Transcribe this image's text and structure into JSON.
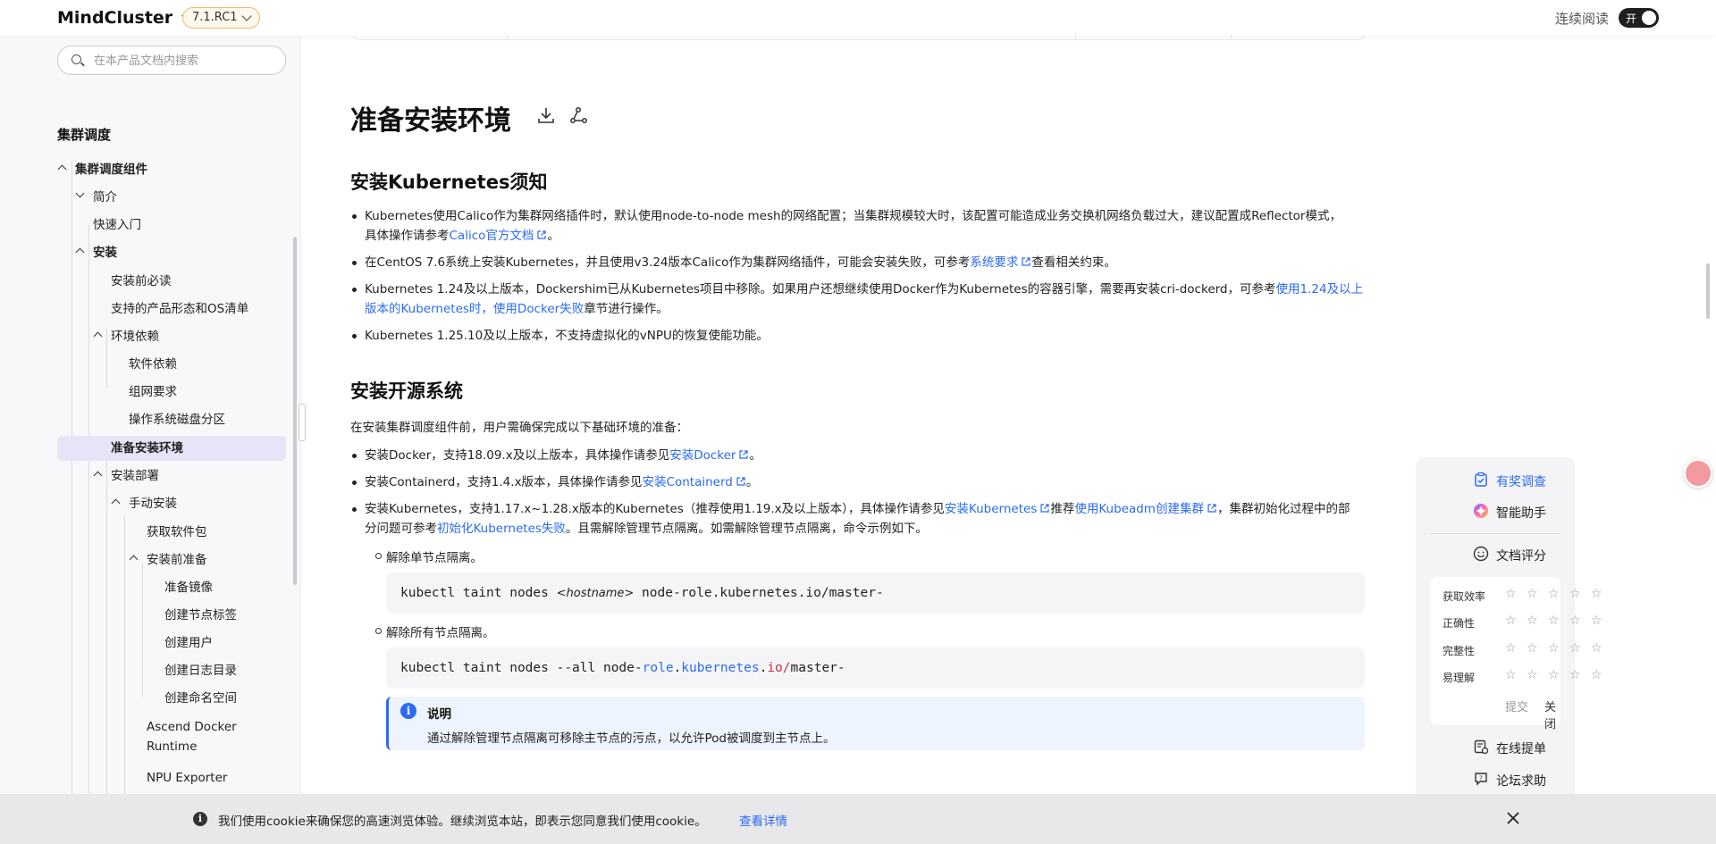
{
  "header": {
    "brand": "MindCluster",
    "version": "7.1.RC1",
    "continuous_reading": "连续阅读",
    "toggle_label": "开"
  },
  "sidebar": {
    "search_placeholder": "在本产品文档内搜索",
    "title": "集群调度",
    "items": [
      {
        "label": "集群调度组件",
        "level": 1,
        "expanded": true
      },
      {
        "label": "简介",
        "level": 2,
        "expanded": true
      },
      {
        "label": "快速入门",
        "level": 2
      },
      {
        "label": "安装",
        "level": 2,
        "expanded": true
      },
      {
        "label": "安装前必读",
        "level": 3
      },
      {
        "label": "支持的产品形态和OS清单",
        "level": 3
      },
      {
        "label": "环境依赖",
        "level": 3,
        "expanded": true
      },
      {
        "label": "软件依赖",
        "level": 4
      },
      {
        "label": "组网要求",
        "level": 4
      },
      {
        "label": "操作系统磁盘分区",
        "level": 4
      },
      {
        "label": "准备安装环境",
        "level": 3,
        "active": true
      },
      {
        "label": "安装部署",
        "level": 3,
        "expanded": true
      },
      {
        "label": "手动安装",
        "level": 4,
        "expanded": true
      },
      {
        "label": "获取软件包",
        "level": 5
      },
      {
        "label": "安装前准备",
        "level": 5,
        "expanded": true
      },
      {
        "label": "准备镜像",
        "level": 6
      },
      {
        "label": "创建节点标签",
        "level": 6
      },
      {
        "label": "创建用户",
        "level": 6
      },
      {
        "label": "创建日志目录",
        "level": 6
      },
      {
        "label": "创建命名空间",
        "level": 6
      },
      {
        "label": "Ascend Docker",
        "label2": "Runtime",
        "level": 5
      },
      {
        "label": "NPU Exporter",
        "level": 5
      }
    ]
  },
  "main": {
    "page_title": "准备安装环境",
    "section1": {
      "heading": "安装Kubernetes须知",
      "b1_text": "Kubernetes使用Calico作为集群网络插件时，默认使用node-to-node mesh的网络配置；当集群规模较大时，该配置可能造成业务交换机网络负载过大，建议配置成Reflector模式，",
      "b1_text2": "具体操作请参考",
      "b1_link": "Calico官方文档",
      "b1_end": "。",
      "b2_text": "在CentOS 7.6系统上安装Kubernetes，并且使用v3.24版本Calico作为集群网络插件，可能会安装失败，可参考",
      "b2_link": "系统要求",
      "b2_end": "查看相关约束。",
      "b3_text": "Kubernetes 1.24及以上版本，Dockershim已从Kubernetes项目中移除。如果用户还想继续使用Docker作为Kubernetes的容器引擎，需要再安装cri-dockerd，可参考",
      "b3_link": "使用1.24及以上",
      "b3_link2": "版本的Kubernetes时，使用Docker失败",
      "b3_end": "章节进行操作。",
      "b4_text": "Kubernetes 1.25.10及以上版本，不支持虚拟化的vNPU的恢复使能功能。"
    },
    "section2": {
      "heading": "安装开源系统",
      "intro": "在安装集群调度组件前，用户需确保完成以下基础环境的准备：",
      "b1_text": "安装Docker，支持18.09.x及以上版本，具体操作请参见",
      "b1_link": "安装Docker",
      "b1_end": "。",
      "b2_text": "安装Containerd，支持1.4.x版本，具体操作请参见",
      "b2_link": "安装Containerd",
      "b2_end": "。",
      "b3_text": "安装Kubernetes，支持1.17.x~1.28.x版本的Kubernetes（推荐使用1.19.x及以上版本），具体操作请参见",
      "b3_link": "安装Kubernetes",
      "b3_mid": "推荐",
      "b3_link2": "使用Kubeadm创建集群",
      "b3_end": "，集群初始化过程中的部",
      "b3_line2_text": "分问题可参考",
      "b3_line2_link": "初始化Kubernetes失败",
      "b3_line2_end": "。且需解除管理节点隔离。如需解除管理节点隔离，命令示例如下。",
      "sub1": "解除单节点隔离。",
      "code1_pre": "kubectl taint nodes ",
      "code1_placeholder": "<hostname>",
      "code1_post": " node-role.kubernetes.io/master-",
      "sub2": "解除所有节点隔离。",
      "code2_a": "kubectl taint nodes --all node-",
      "code2_b": "role",
      "code2_c": ".",
      "code2_d": "kubernetes",
      "code2_e": ".",
      "code2_f": "io/",
      "code2_g": "master-",
      "note_title": "说明",
      "note_text": "通过解除管理节点隔离可移除主节点的污点，以允许Pod被调度到主节点上。"
    }
  },
  "right_panel": {
    "survey": "有奖调查",
    "assistant": "智能助手",
    "rating_title": "文档评分",
    "criteria": [
      "获取效率",
      "正确性",
      "完整性",
      "易理解"
    ],
    "star": "☆",
    "submit": "提交",
    "close": "关闭",
    "ticket": "在线提单",
    "forum": "论坛求助"
  },
  "cookie": {
    "message": "我们使用cookie来确保您的高速浏览体验。继续浏览本站，即表示您同意我们使用cookie。",
    "details": "查看详情"
  },
  "colors": {
    "accent": "#2b6bf3",
    "active_bg": "#e9e3f8",
    "version_border": "#f0b86a"
  }
}
